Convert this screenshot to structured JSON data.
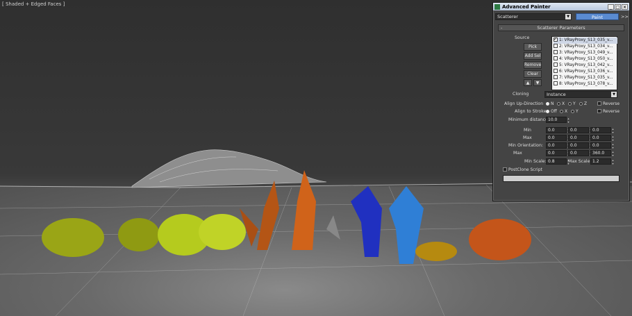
{
  "viewport": {
    "label": "[ Shaded + Edged Faces ]"
  },
  "window": {
    "title": "Advanced Painter",
    "btn_min": "_",
    "btn_max": "□",
    "btn_close": "×"
  },
  "toolbar": {
    "mode": "Scatterer",
    "paint_label": "Paint",
    "more_label": ">>"
  },
  "rollout": {
    "toggle": "-",
    "title": "Scatterer Parameters"
  },
  "source": {
    "label": "Source",
    "pick": "Pick",
    "add_sel": "Add Sel",
    "remove": "Remove",
    "clear": "Clear",
    "up": "▲",
    "down": "▼",
    "items": [
      {
        "label": "1: VRayProxy_S13_035_v...",
        "checked": true
      },
      {
        "label": "2: VRayProxy_S13_034_v...",
        "checked": false
      },
      {
        "label": "3: VRayProxy_S13_049_v...",
        "checked": false
      },
      {
        "label": "4: VRayProxy_S13_050_v...",
        "checked": false
      },
      {
        "label": "5: VRayProxy_S13_042_v...",
        "checked": false
      },
      {
        "label": "6: VRayProxy_S13_036_v...",
        "checked": false
      },
      {
        "label": "7: VRayProxy_S13_035_v...",
        "checked": false
      },
      {
        "label": "8: VRayProxy_S13_078_v...",
        "checked": false
      }
    ]
  },
  "cloning": {
    "label": "Cloning",
    "value": "Instance"
  },
  "align_up": {
    "label": "Align Up-Direction",
    "opts": [
      "N",
      "X",
      "Y",
      "Z"
    ],
    "reverse": "Reverse"
  },
  "align_stroke": {
    "label": "Align to Stroke:",
    "opts": [
      "Off",
      "X",
      "Y"
    ],
    "reverse": "Reverse"
  },
  "min_distance": {
    "label": "Minimum distance:",
    "value": "10.0"
  },
  "params": {
    "min_label": "Min",
    "max_label": "Max",
    "min_orient_label": "Min Orientation:",
    "max2_label": "Max",
    "min_scale_label": "Min Scale:",
    "max_scale_label": "Max Scale:",
    "row1": [
      "0.0",
      "0.0",
      "0.0"
    ],
    "row2": [
      "0.0",
      "0.0",
      "0.0"
    ],
    "row3": [
      "0.0",
      "0.0",
      "0.0"
    ],
    "row4": [
      "0.0",
      "0.0",
      "360.0"
    ],
    "min_scale": "0.8",
    "max_scale": "1.2"
  },
  "postclone": {
    "label": "PostClone Script"
  }
}
